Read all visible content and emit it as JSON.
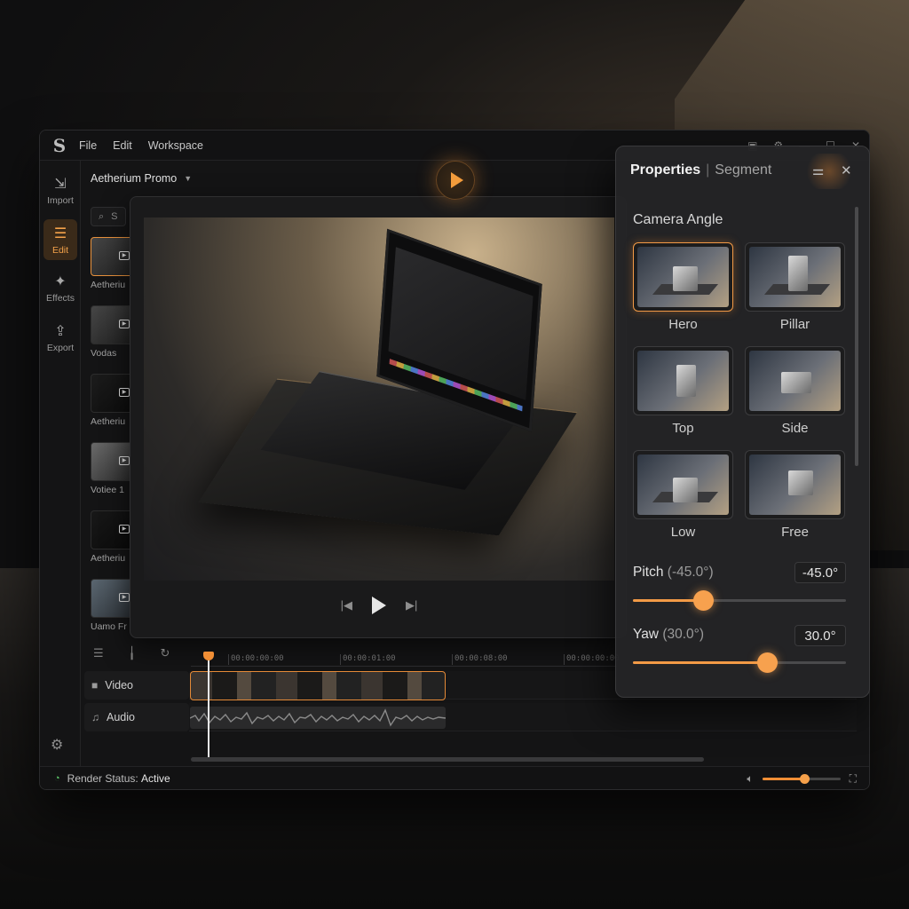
{
  "menu": [
    "File",
    "Edit",
    "Workspace"
  ],
  "rail": [
    {
      "label": "Import",
      "icon": "import-icon"
    },
    {
      "label": "Edit",
      "icon": "sliders-icon",
      "active": true
    },
    {
      "label": "Effects",
      "icon": "magic-wand-icon"
    },
    {
      "label": "Export",
      "icon": "export-icon"
    }
  ],
  "project": {
    "name": "Aetherium Promo"
  },
  "bin": {
    "search_placeholder": "S",
    "items": [
      {
        "label": "Aetheriu"
      },
      {
        "label": "Vodas"
      },
      {
        "label": "Aetheriu"
      },
      {
        "label": "Votiee 1"
      },
      {
        "label": "Aetheriu"
      },
      {
        "label": "Uamo Fr"
      }
    ]
  },
  "timeline": {
    "ticks": [
      "00:00:00:00",
      "00:00:01:00",
      "00:00:08:00",
      "00:00:00:00"
    ],
    "tracks": [
      {
        "label": "Video",
        "icon": "video-camera-icon"
      },
      {
        "label": "Audio",
        "icon": "music-note-icon"
      }
    ]
  },
  "status": {
    "prefix": "Render Status:",
    "value": "Active"
  },
  "volume": {
    "level": 0.55
  },
  "props": {
    "title": "Properties",
    "subtitle": "Segment",
    "section": "Camera Angle",
    "angles": [
      {
        "label": "Hero",
        "selected": true
      },
      {
        "label": "Pillar"
      },
      {
        "label": "Top"
      },
      {
        "label": "Side"
      },
      {
        "label": "Low"
      },
      {
        "label": "Free"
      }
    ],
    "pitch": {
      "label": "Pitch",
      "paren": "(-45.0°)",
      "value": "-45.0°",
      "level": 0.33
    },
    "yaw": {
      "label": "Yaw",
      "paren": "(30.0°)",
      "value": "30.0°",
      "level": 0.63
    }
  },
  "colors": {
    "accent": "#f29a46",
    "status_ok": "#5cc86a"
  }
}
